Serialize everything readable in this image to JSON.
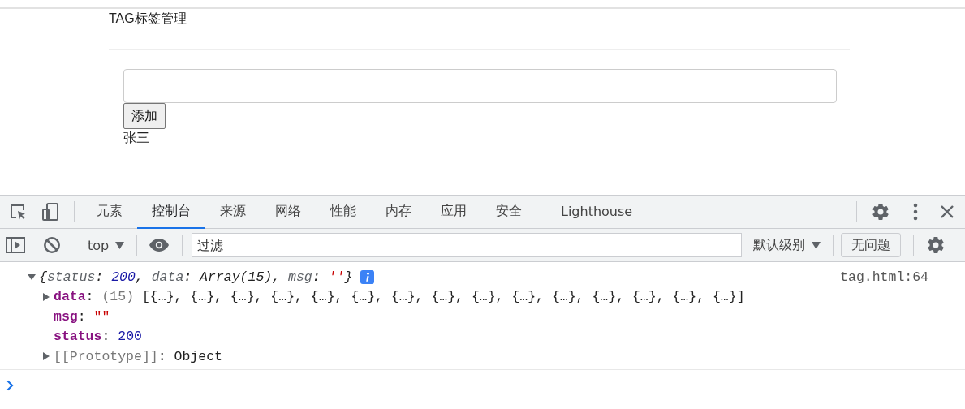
{
  "page": {
    "title": "TAG标签管理",
    "add_button": "添加",
    "tags": [
      "张三"
    ]
  },
  "devtools": {
    "tabs": [
      {
        "label": "元素",
        "selected": false
      },
      {
        "label": "控制台",
        "selected": true
      },
      {
        "label": "来源",
        "selected": false
      },
      {
        "label": "网络",
        "selected": false
      },
      {
        "label": "性能",
        "selected": false
      },
      {
        "label": "内存",
        "selected": false
      },
      {
        "label": "应用",
        "selected": false
      },
      {
        "label": "安全",
        "selected": false
      },
      {
        "label": "Lighthouse",
        "selected": false
      }
    ],
    "toolbar": {
      "context": "top",
      "filter": {
        "placeholder": "过滤"
      },
      "levels": "默认级别",
      "issues": "无问题"
    },
    "console": {
      "messages": [
        {
          "expanded": true,
          "source": "tag.html:64",
          "summary": [
            {
              "kind": "punct",
              "text": "{"
            },
            {
              "kind": "key",
              "text": "status"
            },
            {
              "kind": "punct",
              "text": ": "
            },
            {
              "kind": "number",
              "text": "200"
            },
            {
              "kind": "punct",
              "text": ", "
            },
            {
              "kind": "key",
              "text": "data"
            },
            {
              "kind": "punct",
              "text": ": "
            },
            {
              "kind": "plain",
              "text": "Array(15)"
            },
            {
              "kind": "punct",
              "text": ", "
            },
            {
              "kind": "key",
              "text": "msg"
            },
            {
              "kind": "punct",
              "text": ": "
            },
            {
              "kind": "string",
              "text": "''"
            },
            {
              "kind": "punct",
              "text": "}"
            }
          ],
          "children": [
            {
              "key": "data",
              "sep": ": ",
              "kind": "array",
              "expandable": true,
              "expanded": false,
              "count": "(15)",
              "value": "[{…}, {…}, {…}, {…}, {…}, {…}, {…}, {…}, {…}, {…}, {…}, {…}, {…}, {…}, {…}]"
            },
            {
              "key": "msg",
              "sep": ": ",
              "kind": "string",
              "expandable": false,
              "value": "\"\""
            },
            {
              "key": "status",
              "sep": ": ",
              "kind": "number",
              "expandable": false,
              "value": "200"
            },
            {
              "key": "[[Prototype]]",
              "sep": ": ",
              "kind": "internal",
              "expandable": true,
              "expanded": false,
              "value": "Object"
            }
          ]
        }
      ]
    }
  }
}
